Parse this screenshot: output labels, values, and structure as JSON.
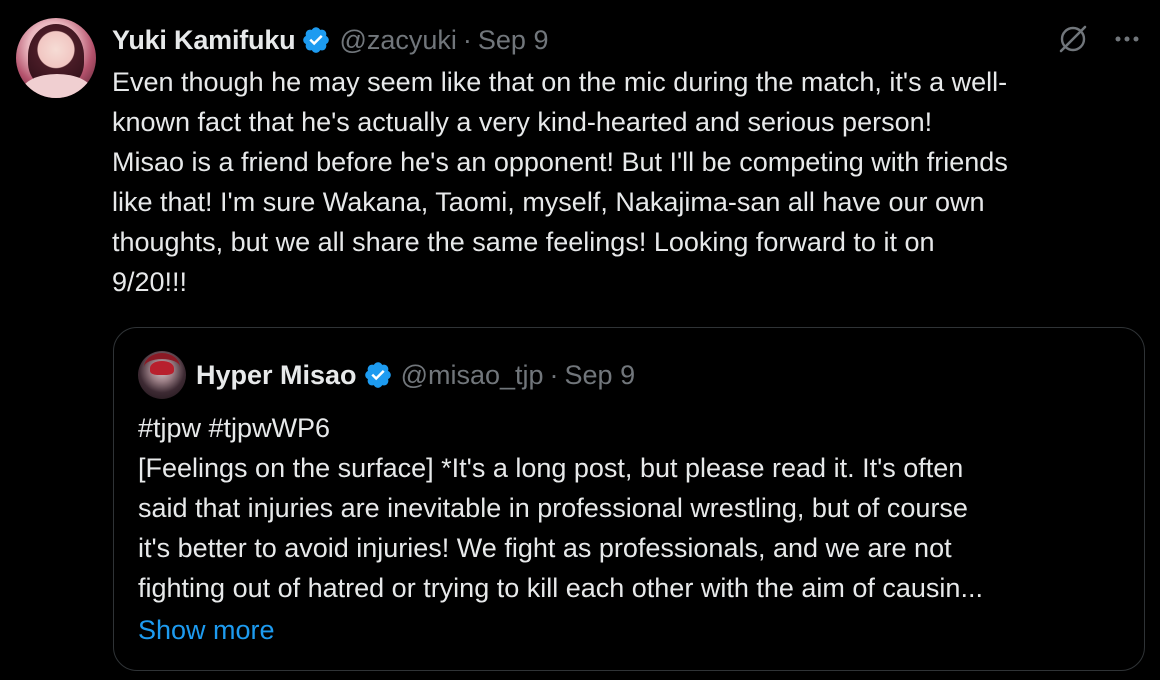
{
  "tweet": {
    "author": {
      "name": "Yuki Kamifuku",
      "handle": "@zacyuki",
      "verified": true
    },
    "separator": "·",
    "date": "Sep 9",
    "text": "Even though he may seem like that on the mic during the match, it's a well-\nknown fact that he's actually a very kind-hearted and serious person!\nMisao is a friend before he's an opponent! But I'll be competing with friends\nlike that! I'm sure Wakana, Taomi, myself, Nakajima-san all have our own\nthoughts, but we all share the same feelings! Looking forward to it on\n9/20!!!",
    "icons": {
      "grok": "grok-icon",
      "more": "more-icon"
    }
  },
  "quoted_tweet": {
    "author": {
      "name": "Hyper Misao",
      "handle": "@misao_tjp",
      "verified": true
    },
    "separator": "·",
    "date": "Sep 9",
    "text": "#tjpw #tjpwWP6\n[Feelings on the surface] *It's a long post, but please read it. It's often\nsaid that injuries are inevitable in professional wrestling, but of course\nit's better to avoid injuries! We fight as professionals, and we are not\nfighting out of hatred or trying to kill each other with the aim of causin...",
    "show_more_label": "Show more"
  },
  "colors": {
    "background": "#000000",
    "text_primary": "#e7e9ea",
    "text_secondary": "#71767b",
    "link": "#1d9bf0",
    "verified_badge": "#1d9bf0",
    "border": "#2f3336"
  }
}
